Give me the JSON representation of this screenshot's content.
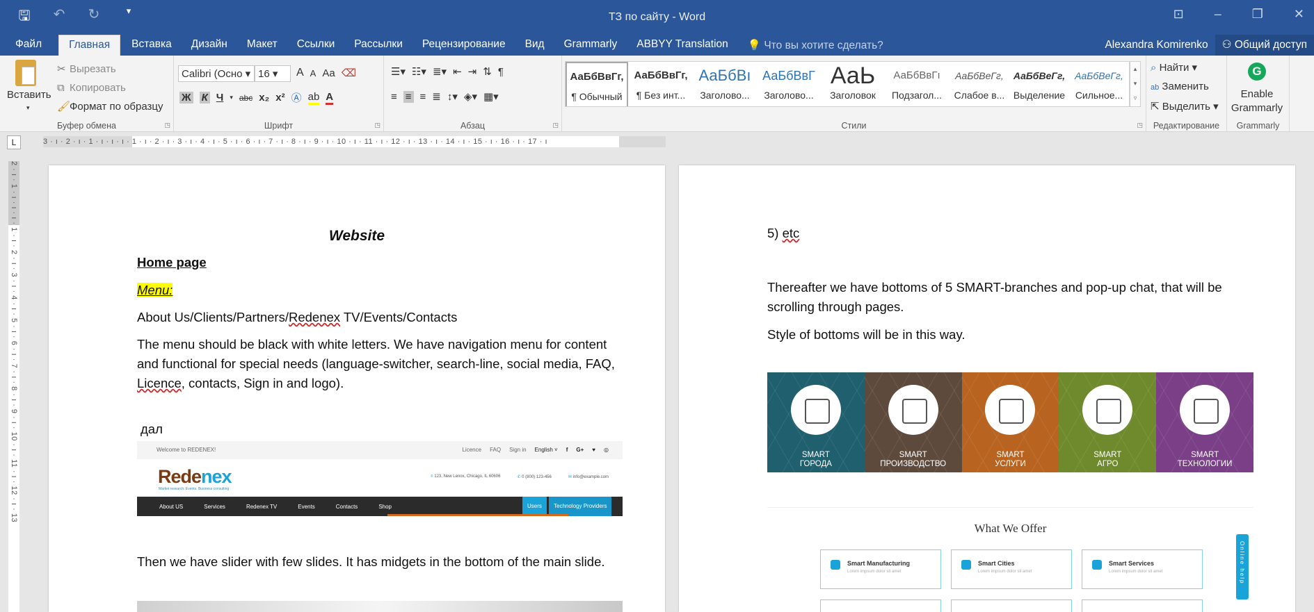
{
  "window": {
    "title": "ТЗ по сайту - Word",
    "qat": [
      "save-icon",
      "undo-icon",
      "redo-icon",
      "customize-icon"
    ]
  },
  "tabs": [
    {
      "label": "Файл"
    },
    {
      "label": "Главная"
    },
    {
      "label": "Вставка"
    },
    {
      "label": "Дизайн"
    },
    {
      "label": "Макет"
    },
    {
      "label": "Ссылки"
    },
    {
      "label": "Рассылки"
    },
    {
      "label": "Рецензирование"
    },
    {
      "label": "Вид"
    },
    {
      "label": "Grammarly"
    },
    {
      "label": "ABBYY Translation"
    }
  ],
  "tell_me": "Что вы хотите сделать?",
  "user_name": "Alexandra Komirenko",
  "share_label": "Общий доступ",
  "ribbon": {
    "clipboard": {
      "paste": "Вставить",
      "cut": "Вырезать",
      "copy": "Копировать",
      "format_painter": "Формат по образцу",
      "label": "Буфер обмена"
    },
    "font": {
      "name": "Calibri (Осно",
      "size": "16",
      "grow": "A",
      "shrink": "A",
      "case": "Aa",
      "bold": "Ж",
      "italic": "К",
      "underline": "Ч",
      "strike": "abc",
      "subscript": "x₂",
      "superscript": "x²",
      "label": "Шрифт"
    },
    "paragraph": {
      "label": "Абзац"
    },
    "styles": {
      "label": "Стили",
      "items": [
        {
          "sample": "АаБбВвГг,",
          "name": "¶ Обычный"
        },
        {
          "sample": "АаБбВвГг,",
          "name": "¶ Без инт..."
        },
        {
          "sample": "АаБбВı",
          "name": "Заголово..."
        },
        {
          "sample": "АаБбВвГ",
          "name": "Заголово..."
        },
        {
          "sample": "АаЬ",
          "name": "Заголовок"
        },
        {
          "sample": "АаБбВвГı",
          "name": "Подзагол..."
        },
        {
          "sample": "АаБбВеГг,",
          "name": "Слабое в..."
        },
        {
          "sample": "АаБбВеГг,",
          "name": "Выделение"
        },
        {
          "sample": "АаБбВеГг,",
          "name": "Сильное..."
        }
      ]
    },
    "editing": {
      "find": "Найти",
      "replace": "Заменить",
      "select": "Выделить",
      "label": "Редактирование"
    },
    "grammarly": {
      "enable": "Enable",
      "brand": "Grammarly",
      "label": "Grammarly"
    }
  },
  "ruler": {
    "corner": "L",
    "h_scale": "3 · ı · 2 · ı · 1 · ı · ı · ı · 1 · ı · 2 · ı · 3 · ı · 4 · ı · 5 · ı · 6 · ı · 7 · ı · 8 · ı · 9 · ı · 10 · ı · 11 · ı · 12 · ı · 13 · ı · 14 · ı · 15 · ı · 16 · ı · 17 · ı",
    "v_scale": "2 · ı · 1 · ı · ı · ı · 1 · ı · 2 · ı · 3 · ı · 4 · ı · 5 · ı · 6 · ı · 7 · ı · 8 · ı · 9 · ı · 10 · ı · 11 · ı · 12 · ı · 13"
  },
  "page1": {
    "title": "Website",
    "home": "Home page",
    "menu": "Menu:",
    "menu_items_a": "About Us/Clients/Partners/",
    "menu_items_redenex": "Redenex",
    "menu_items_b": " TV/Events/Contacts",
    "p1_a": "The menu should be black with white letters. We have navigation menu for content and functional for special needs (language-switcher, search-line, social media, FAQ, ",
    "p1_licence": "Licence",
    "p1_b": ", contacts, Sign in and logo).",
    "dal": "дал",
    "p2": "Then we have slider with few slides. It has midgets in the bottom of the main slide."
  },
  "site": {
    "welcome": "Welcome to REDENEX!",
    "top_links": [
      "Licence",
      "FAQ",
      "Sign in",
      "English ˅",
      "f",
      "G+",
      "♥",
      "◎"
    ],
    "logo_a": "Rede",
    "logo_b": "nex",
    "logo_sub": "Market research. Events. Business consulting",
    "address": "123, New Lenox, Chicago, IL 60606",
    "phone": "0 (800) 123-456",
    "email": "info@example.com",
    "nav": [
      "About US",
      "Services",
      "Redenex TV",
      "Events",
      "Contacts",
      "Shop"
    ],
    "nav_users": "Users",
    "nav_providers": "Technology Providers"
  },
  "page2": {
    "etc_a": "5) ",
    "etc_b": "etc",
    "p1": "Thereafter we have bottoms of 5 SMART-branches and pop-up chat, that will be scrolling through pages.",
    "p2": "Style of bottoms will be in this way."
  },
  "smart_tiles": [
    {
      "line1": "SMART",
      "line2": "ГОРОДА",
      "color": "#1f5f6e"
    },
    {
      "line1": "SMART",
      "line2": "ПРОИЗВОДСТВО",
      "color": "#5e4a3c"
    },
    {
      "line1": "SMART",
      "line2": "УСЛУГИ",
      "color": "#b8631f"
    },
    {
      "line1": "SMART",
      "line2": "АГРО",
      "color": "#6e8a2c"
    },
    {
      "line1": "SMART",
      "line2": "ТЕХНОЛОГИИ",
      "color": "#7a3f86"
    }
  ],
  "offer": {
    "title": "What We Offer",
    "cards": [
      {
        "title": "Smart Manufacturing",
        "sub": "Lorem impsum dolor sit amet"
      },
      {
        "title": "Smart Cities",
        "sub": "Lorem impsum dolor sit amet"
      },
      {
        "title": "Smart Services",
        "sub": "Lorem impsum dolor sit amet"
      }
    ],
    "online_help": "Online help"
  },
  "colors": {
    "word_blue": "#2b579a",
    "highlight": "#ffff00",
    "site_accent": "#1aa3d9"
  }
}
